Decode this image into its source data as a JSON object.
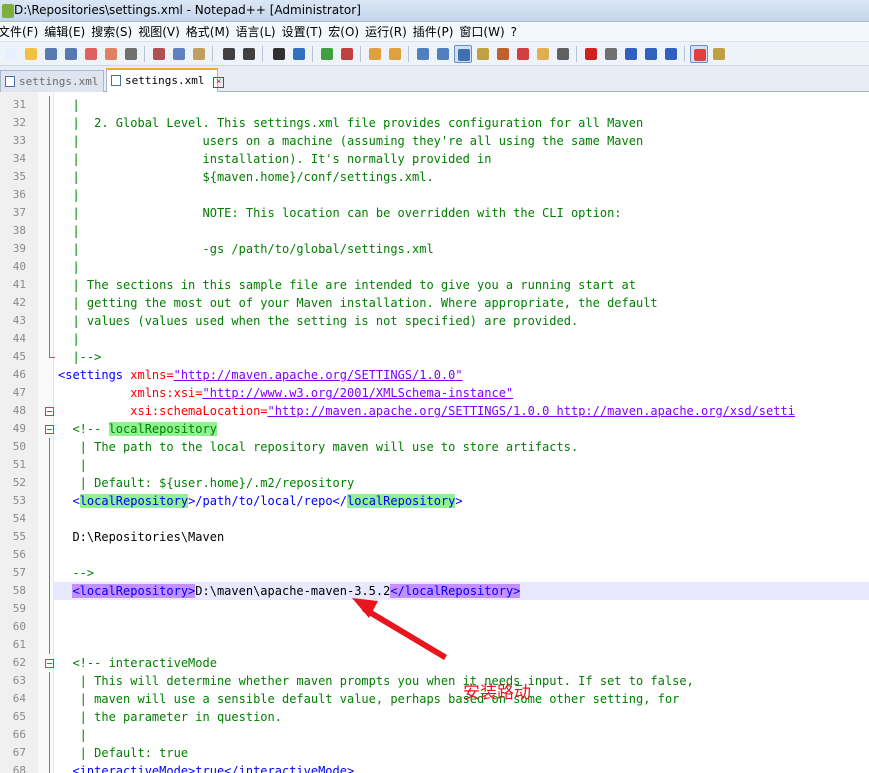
{
  "window": {
    "title": "D:\\Repositories\\settings.xml - Notepad++ [Administrator]"
  },
  "menu": [
    "文件(F)",
    "编辑(E)",
    "搜索(S)",
    "视图(V)",
    "格式(M)",
    "语言(L)",
    "设置(T)",
    "宏(O)",
    "运行(R)",
    "插件(P)",
    "窗口(W)",
    "?"
  ],
  "tabs": [
    {
      "label": "settings.xml",
      "active": false
    },
    {
      "label": "settings.xml",
      "active": true
    }
  ],
  "editor": {
    "lines": [
      {
        "n": "31",
        "text": "  |"
      },
      {
        "n": "32",
        "text": "  |  2. Global Level. This settings.xml file provides configuration for all Maven"
      },
      {
        "n": "33",
        "text": "  |                 users on a machine (assuming they're all using the same Maven"
      },
      {
        "n": "34",
        "text": "  |                 installation). It's normally provided in"
      },
      {
        "n": "35",
        "text": "  |                 ${maven.home}/conf/settings.xml."
      },
      {
        "n": "36",
        "text": "  |"
      },
      {
        "n": "37",
        "text": "  |                 NOTE: This location can be overridden with the CLI option:"
      },
      {
        "n": "38",
        "text": "  |"
      },
      {
        "n": "39",
        "text": "  |                 -gs /path/to/global/settings.xml"
      },
      {
        "n": "40",
        "text": "  |"
      },
      {
        "n": "41",
        "text": "  | The sections in this sample file are intended to give you a running start at"
      },
      {
        "n": "42",
        "text": "  | getting the most out of your Maven installation. Where appropriate, the default"
      },
      {
        "n": "43",
        "text": "  | values (values used when the setting is not specified) are provided."
      },
      {
        "n": "44",
        "text": "  |"
      },
      {
        "n": "45",
        "text": "  |-->"
      },
      {
        "n": "46",
        "text": ""
      },
      {
        "n": "47",
        "text": ""
      },
      {
        "n": "48",
        "text": ""
      },
      {
        "n": "49",
        "text": ""
      },
      {
        "n": "50",
        "text": "   | The path to the local repository maven will use to store artifacts."
      },
      {
        "n": "51",
        "text": "   |"
      },
      {
        "n": "52",
        "text": "   | Default: ${user.home}/.m2/repository"
      },
      {
        "n": "53",
        "text": ""
      },
      {
        "n": "54",
        "text": ""
      },
      {
        "n": "55",
        "text": "  D:\\Repositories\\Maven"
      },
      {
        "n": "56",
        "text": ""
      },
      {
        "n": "57",
        "text": "  -->"
      },
      {
        "n": "58",
        "text": ""
      },
      {
        "n": "59",
        "text": ""
      },
      {
        "n": "60",
        "text": ""
      },
      {
        "n": "61",
        "text": ""
      },
      {
        "n": "62",
        "text": "  <!-- interactiveMode"
      },
      {
        "n": "63",
        "text": "   | This will determine whether maven prompts you when it needs input. If set to false,"
      },
      {
        "n": "64",
        "text": "   | maven will use a sensible default value, perhaps based on some other setting, for"
      },
      {
        "n": "65",
        "text": "   | the parameter in question."
      },
      {
        "n": "66",
        "text": "   |"
      },
      {
        "n": "67",
        "text": "   | Default: true"
      },
      {
        "n": "68",
        "text": "  <interactiveMode>true</interactiveMode>"
      }
    ],
    "settings_tag": {
      "open": "<settings ",
      "xmlns_attr": "xmlns=",
      "xmlns_val": "\"http://maven.apache.org/SETTINGS/1.0.0\"",
      "xsi_attr": "xmlns:xsi=",
      "xsi_val": "\"http://www.w3.org/2001/XMLSchema-instance\"",
      "schema_attr": "xsi:schemaLocation=",
      "schema_val": "\"http://maven.apache.org/SETTINGS/1.0.0 http://maven.apache.org/xsd/setti"
    },
    "local_repo_comment": {
      "prefix": "  <!-- ",
      "word": "localRepository"
    },
    "local_repo_sample": {
      "lt": "  <",
      "tag": "localRepository",
      "middle": ">/path/to/local/repo</",
      "gt": ">"
    },
    "local_repo_active": {
      "open_tag": "<localRepository>",
      "value": "D:\\maven\\apache-maven-3.5.2",
      "close_tag": "</localRepository>"
    }
  },
  "annotation": {
    "label": "安装路动",
    "color": "#e8141e"
  }
}
